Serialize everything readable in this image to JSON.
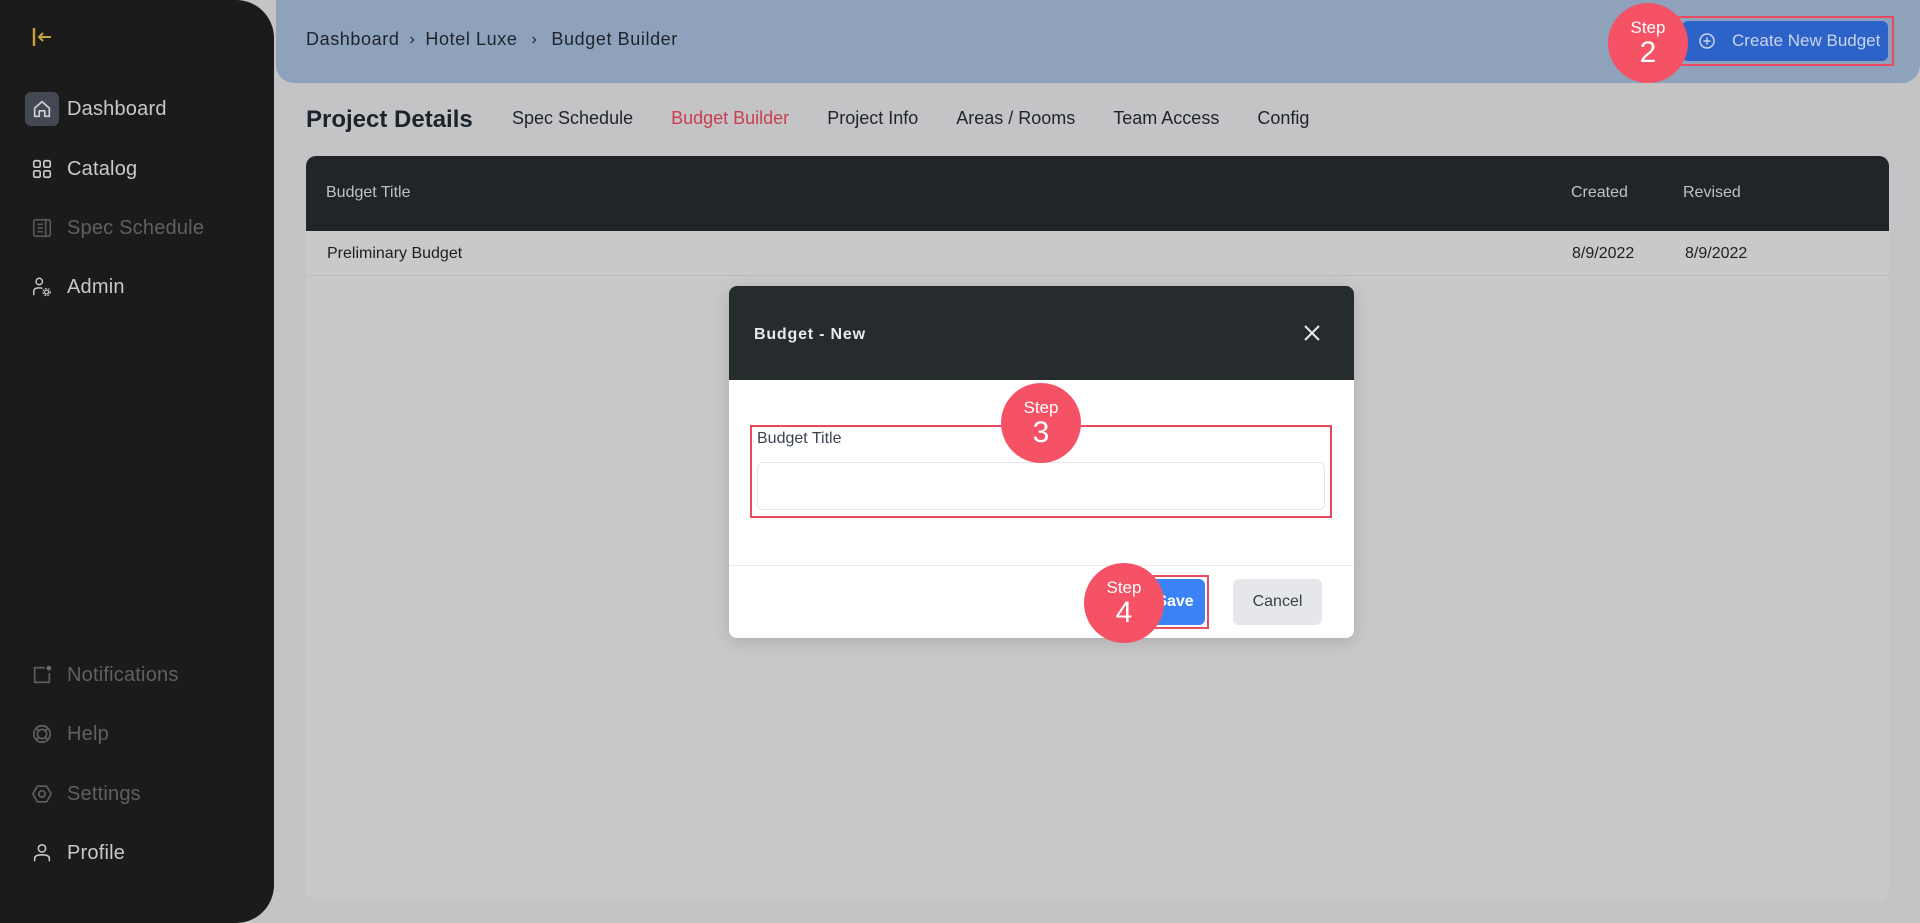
{
  "sidebar": {
    "collapse_icon": "collapse-left-icon",
    "items": [
      {
        "label": "Dashboard",
        "icon": "home-icon",
        "active": true
      },
      {
        "label": "Catalog",
        "icon": "grid-icon"
      },
      {
        "label": "Spec Schedule",
        "icon": "document-icon",
        "disabled": true
      },
      {
        "label": "Admin",
        "icon": "user-gear-icon"
      }
    ],
    "bottom_items": [
      {
        "label": "Notifications",
        "icon": "notification-icon",
        "disabled": true
      },
      {
        "label": "Help",
        "icon": "lifebuoy-icon",
        "disabled": true
      },
      {
        "label": "Settings",
        "icon": "settings-icon",
        "disabled": true
      },
      {
        "label": "Profile",
        "icon": "user-icon"
      }
    ]
  },
  "breadcrumb": {
    "items": [
      "Dashboard",
      "Hotel Luxe",
      "Budget Builder"
    ],
    "separator": "›"
  },
  "toolbar": {
    "create_label": "Create New Budget"
  },
  "page": {
    "title": "Project Details",
    "tabs": [
      {
        "label": "Spec Schedule"
      },
      {
        "label": "Budget Builder",
        "active": true
      },
      {
        "label": "Project Info"
      },
      {
        "label": "Areas / Rooms"
      },
      {
        "label": "Team Access"
      },
      {
        "label": "Config"
      }
    ]
  },
  "table": {
    "columns": [
      "Budget Title",
      "Created",
      "Revised"
    ],
    "rows": [
      {
        "title": "Preliminary Budget",
        "created": "8/9/2022",
        "revised": "8/9/2022"
      }
    ]
  },
  "modal": {
    "title": "Budget - New",
    "field_label": "Budget Title",
    "field_value": "",
    "field_placeholder": "",
    "save_label": "Save",
    "cancel_label": "Cancel"
  },
  "steps": [
    {
      "label": "Step",
      "number": "2"
    },
    {
      "label": "Step",
      "number": "3"
    },
    {
      "label": "Step",
      "number": "4"
    }
  ],
  "colors": {
    "accent_active_tab": "#c8404f",
    "primary_button": "#3b82f6",
    "step_badge": "#f55266",
    "highlight_outline": "#e84a5f"
  }
}
